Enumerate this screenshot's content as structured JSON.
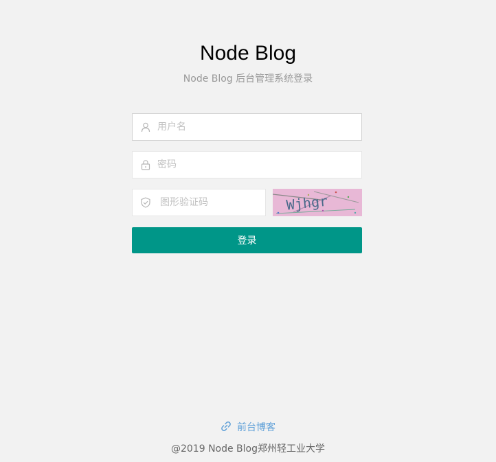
{
  "header": {
    "title": "Node Blog",
    "subtitle": "Node Blog 后台管理系统登录"
  },
  "form": {
    "username": {
      "placeholder": "用户名",
      "value": "",
      "icon": "user-icon"
    },
    "password": {
      "placeholder": "密码",
      "value": "",
      "icon": "lock-icon"
    },
    "captcha": {
      "placeholder": "图形验证码",
      "value": "",
      "icon": "shield-icon",
      "image_text": "Wjhgr"
    },
    "submit_label": "登录"
  },
  "footer": {
    "front_link_label": "前台博客",
    "front_link_icon": "link-icon",
    "copyright": "@2019 Node Blog郑州轻工业大学"
  },
  "colors": {
    "background": "#f2f2f2",
    "primary": "#009688",
    "link": "#5fa0d8",
    "captcha_bg": "#e8b8d6"
  }
}
